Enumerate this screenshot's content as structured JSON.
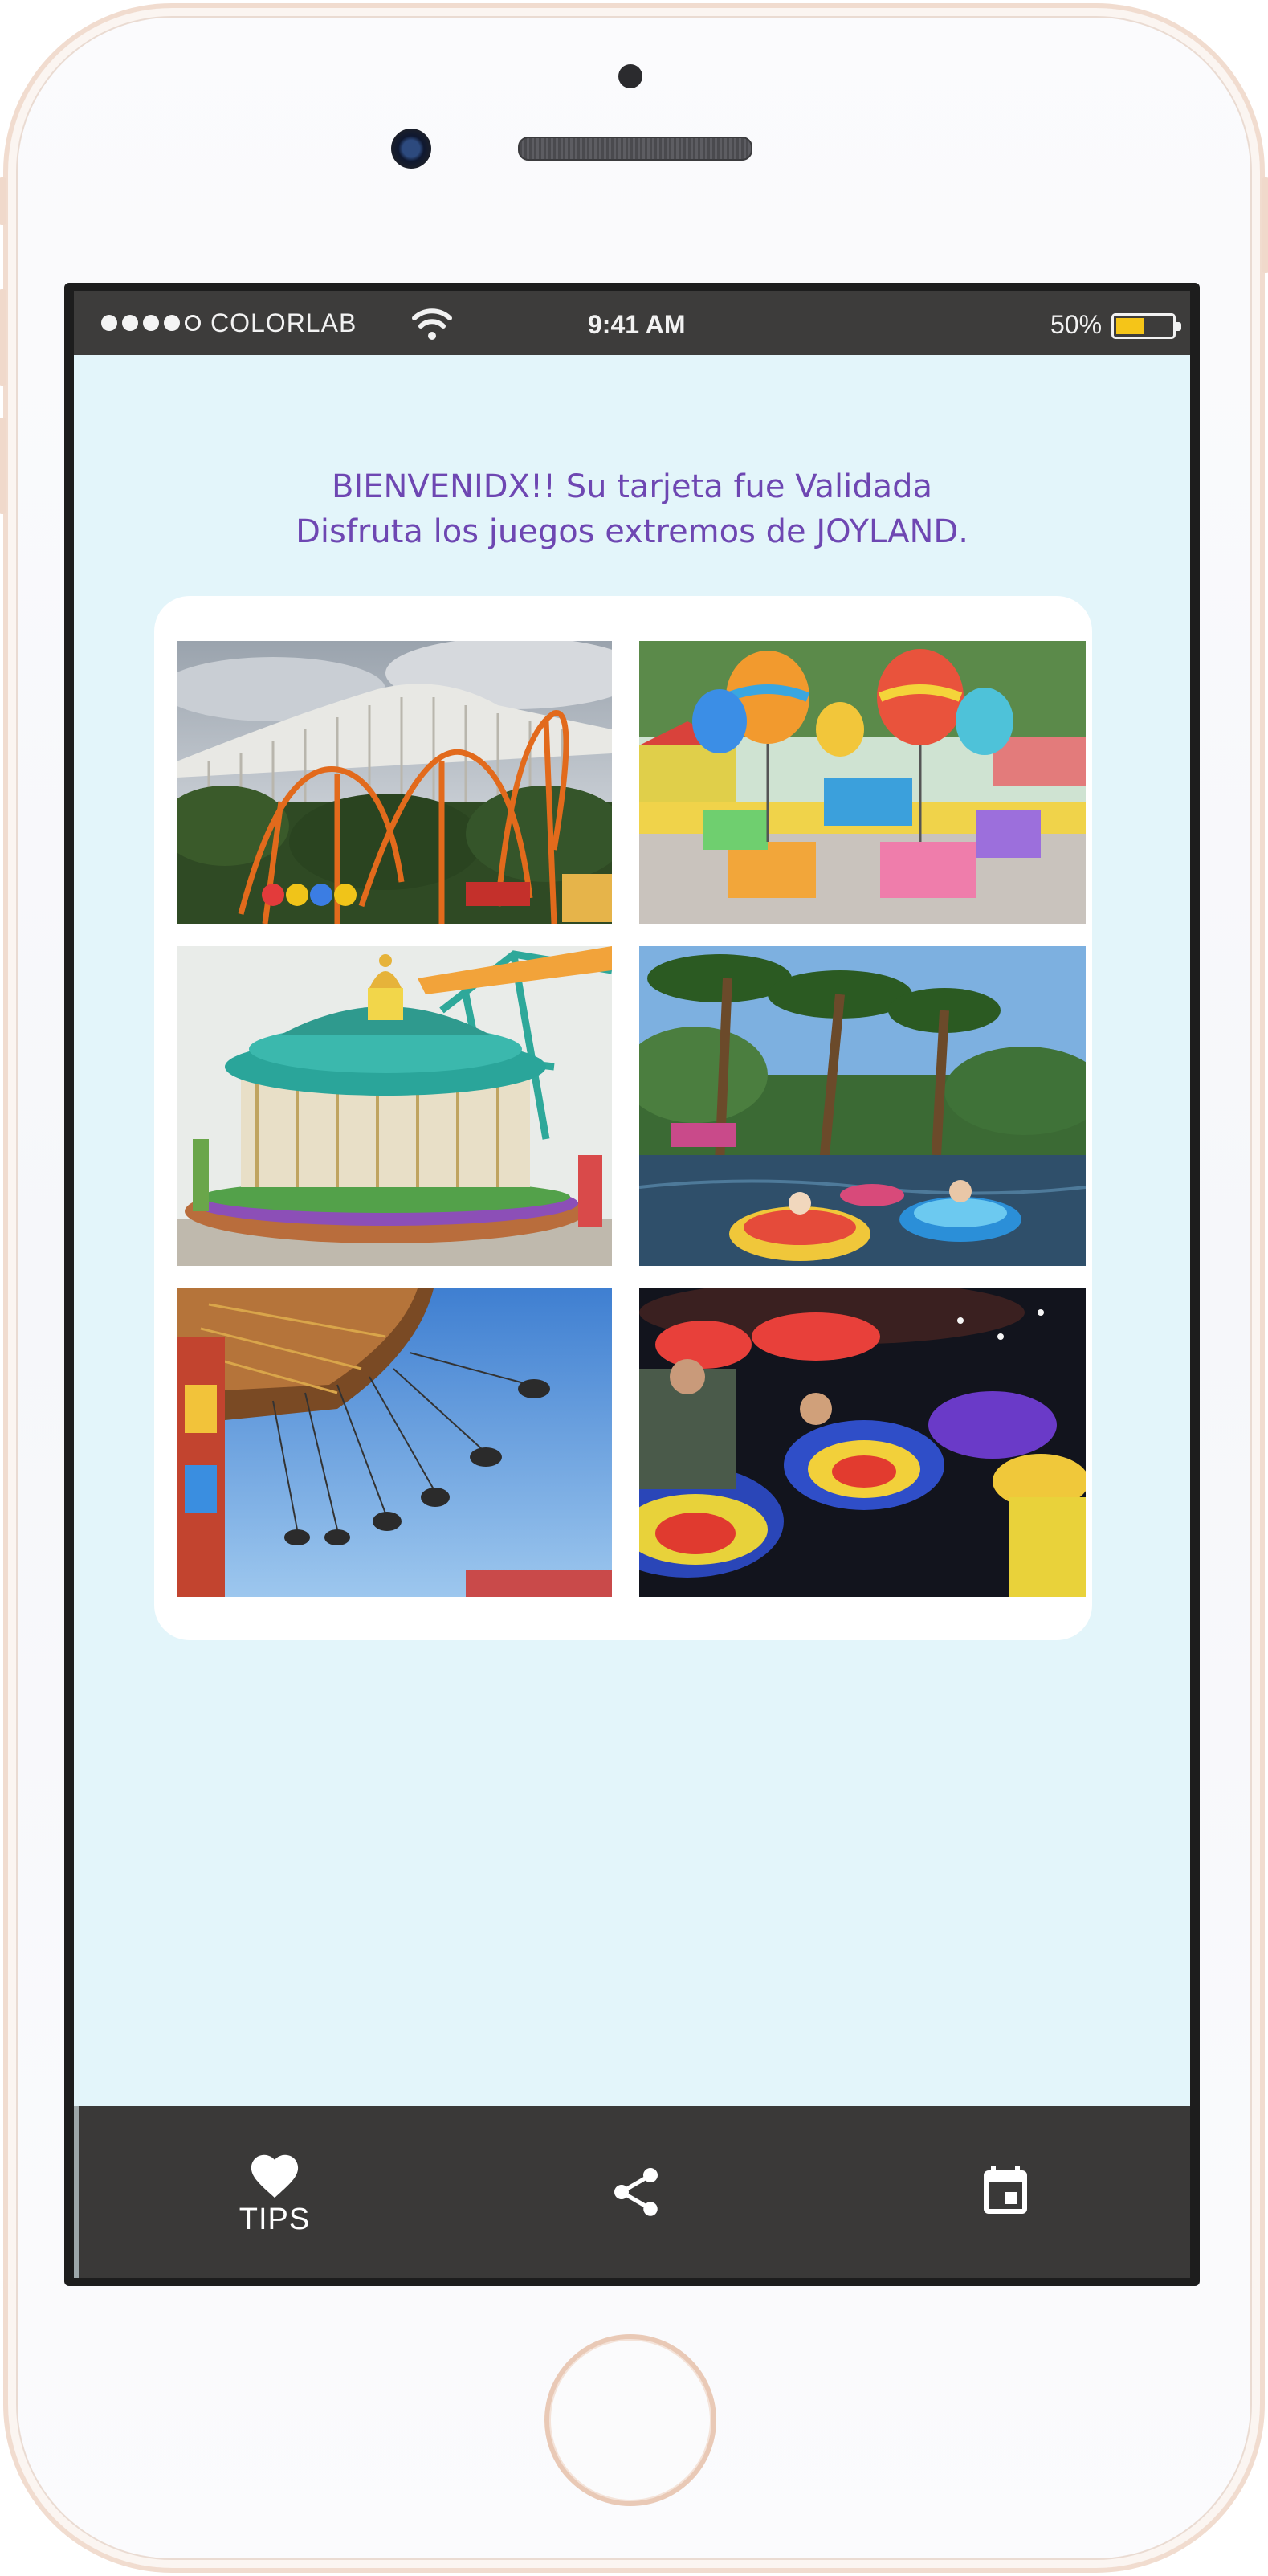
{
  "status_bar": {
    "carrier": "COLORLAB",
    "time": "9:41 AM",
    "battery_percent": "50%",
    "battery_level": 0.5,
    "signal_bars_filled": 4,
    "signal_bars_total": 5
  },
  "welcome": {
    "line1": "BIENVENIDX!! Su tarjeta fue Validada",
    "line2": "Disfruta los juegos extremos de JOYLAND."
  },
  "gallery": {
    "photos": [
      {
        "subject": "roller coaster"
      },
      {
        "subject": "balloon ride"
      },
      {
        "subject": "carousel"
      },
      {
        "subject": "bumper boats"
      },
      {
        "subject": "swing ride"
      },
      {
        "subject": "spinning ride"
      }
    ]
  },
  "nav": {
    "tips_label": "TIPS",
    "tips_icon": "heart-icon",
    "share_icon": "share-icon",
    "calendar_icon": "calendar-icon"
  },
  "colors": {
    "accent_text": "#6e47b2",
    "screen_background": "#e3f5fa",
    "bars": "#3a3938",
    "battery": "#f5c518"
  }
}
